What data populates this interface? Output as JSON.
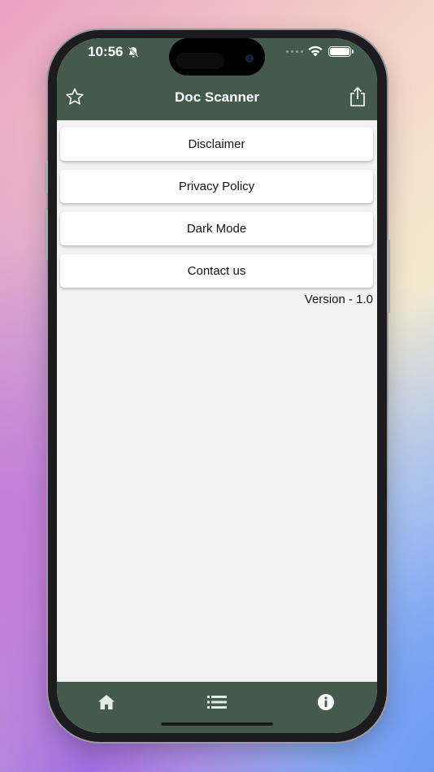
{
  "status_bar": {
    "time": "10:56"
  },
  "header": {
    "title": "Doc Scanner"
  },
  "menu": {
    "items": [
      {
        "label": "Disclaimer"
      },
      {
        "label": "Privacy Policy"
      },
      {
        "label": "Dark Mode"
      },
      {
        "label": "Contact us"
      }
    ]
  },
  "footer_text": {
    "version": "Version - 1.0"
  },
  "tabs": [
    {
      "icon": "home-icon"
    },
    {
      "icon": "list-icon"
    },
    {
      "icon": "info-icon"
    }
  ],
  "colors": {
    "bar": "#445a4c",
    "screen_bg": "#f2f2f2",
    "button_bg": "#ffffff"
  }
}
